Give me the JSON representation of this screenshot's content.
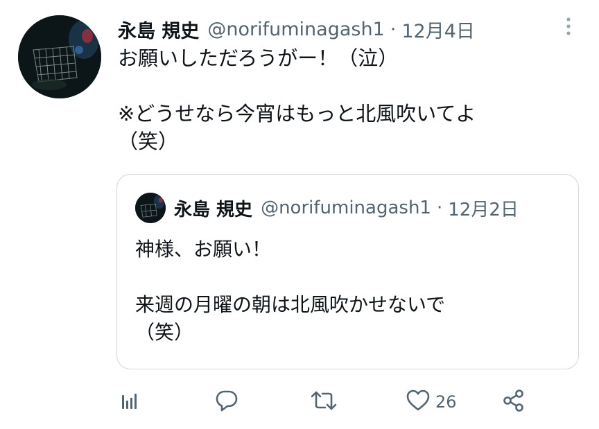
{
  "tweet": {
    "display_name": "永島 規史",
    "handle": "@norifuminagash1",
    "separator": "·",
    "date": "12月4日",
    "body_lines": [
      "お願いしただろうがー！（泣）",
      "※どうせなら今宵はもっと北風吹いてよ",
      "（笑）"
    ]
  },
  "quoted": {
    "display_name": "永島 規史",
    "handle": "@norifuminagash1",
    "separator": "·",
    "date": "12月2日",
    "body_lines": [
      "神様、お願い！",
      "来週の月曜の朝は北風吹かせないで",
      "（笑）"
    ]
  },
  "actions": {
    "analytics_icon": "analytics-icon",
    "reply_icon": "reply-icon",
    "retweet_icon": "retweet-icon",
    "like_icon": "heart-icon",
    "like_count": "26",
    "share_icon": "share-icon"
  },
  "colors": {
    "text": "#0f1419",
    "secondary": "#536471",
    "border": "#cfd9de"
  }
}
